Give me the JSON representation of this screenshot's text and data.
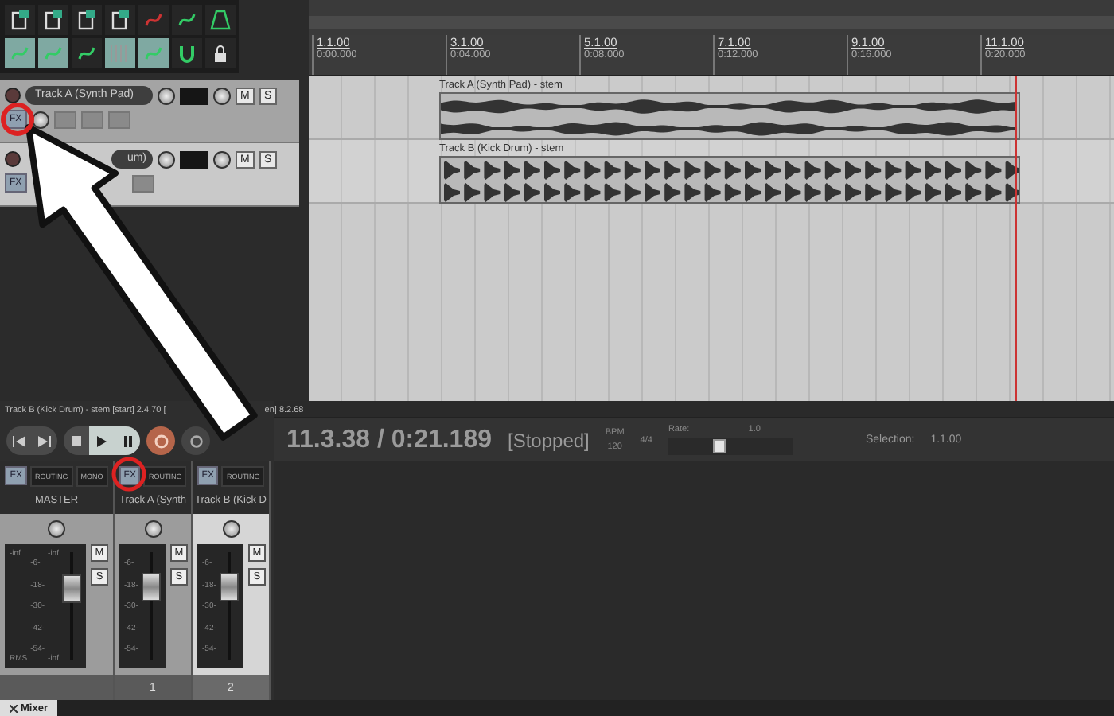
{
  "tracks": [
    {
      "name": "Track A (Synth Pad)",
      "selected": false,
      "fx_label": "FX",
      "mute_label": "M",
      "solo_label": "S"
    },
    {
      "name": "um)",
      "selected": true,
      "fx_label": "FX",
      "mute_label": "M",
      "solo_label": "S"
    }
  ],
  "ruler": [
    {
      "bar": "1.1.00",
      "time": "0:00.000"
    },
    {
      "bar": "3.1.00",
      "time": "0:04.000"
    },
    {
      "bar": "5.1.00",
      "time": "0:08.000"
    },
    {
      "bar": "7.1.00",
      "time": "0:12.000"
    },
    {
      "bar": "9.1.00",
      "time": "0:16.000"
    },
    {
      "bar": "11.1.00",
      "time": "0:20.000"
    }
  ],
  "items": [
    {
      "label": "Track A (Synth Pad) - stem",
      "kind": "pad"
    },
    {
      "label": "Track B (Kick Drum) - stem",
      "kind": "kick"
    }
  ],
  "status_text": [
    "Track B (Kick Drum) - stem [start] 2.4.70 [",
    "en] 8.2.68"
  ],
  "transport": {
    "position": "11.3.38 / 0:21.189",
    "state": "[Stopped]",
    "bpm_label": "BPM",
    "bpm": "120",
    "time_signature": "4/4",
    "rate_label": "Rate:",
    "rate": "1.0",
    "rate_slider": {
      "level": 0.4
    },
    "selection_label": "Selection:",
    "selection_start": "1.1.00"
  },
  "mixer": {
    "strips": [
      {
        "kind": "master",
        "name": "MASTER",
        "scale": [
          "-6-",
          "-18-",
          "-30-",
          "-42-",
          "-54-"
        ],
        "selected": false,
        "fx_label": "FX",
        "routing_label": "ROUTING",
        "mono_label": "MONO",
        "peak_left": "-inf",
        "peak_right": "-inf",
        "rms_label": "RMS",
        "rms_value": "-inf",
        "mute_label": "M",
        "solo_label": "S",
        "fader": {
          "level": 0.7
        }
      },
      {
        "kind": "track",
        "name": "Track A (Synth",
        "scale": [
          "-6-",
          "-18-",
          "-30-",
          "-42-",
          "-54-"
        ],
        "number": "1",
        "selected": false,
        "fx_label": "FX",
        "routing_label": "ROUTING",
        "mute_label": "M",
        "solo_label": "S",
        "fader": {
          "level": 0.72
        }
      },
      {
        "kind": "track",
        "name": "Track B (Kick D",
        "scale": [
          "-6-",
          "-18-",
          "-30-",
          "-42-",
          "-54-"
        ],
        "number": "2",
        "selected": true,
        "fx_label": "FX",
        "routing_label": "ROUTING",
        "mute_label": "M",
        "solo_label": "S",
        "fader": {
          "level": 0.72
        }
      }
    ]
  },
  "docker_tab": "Mixer"
}
